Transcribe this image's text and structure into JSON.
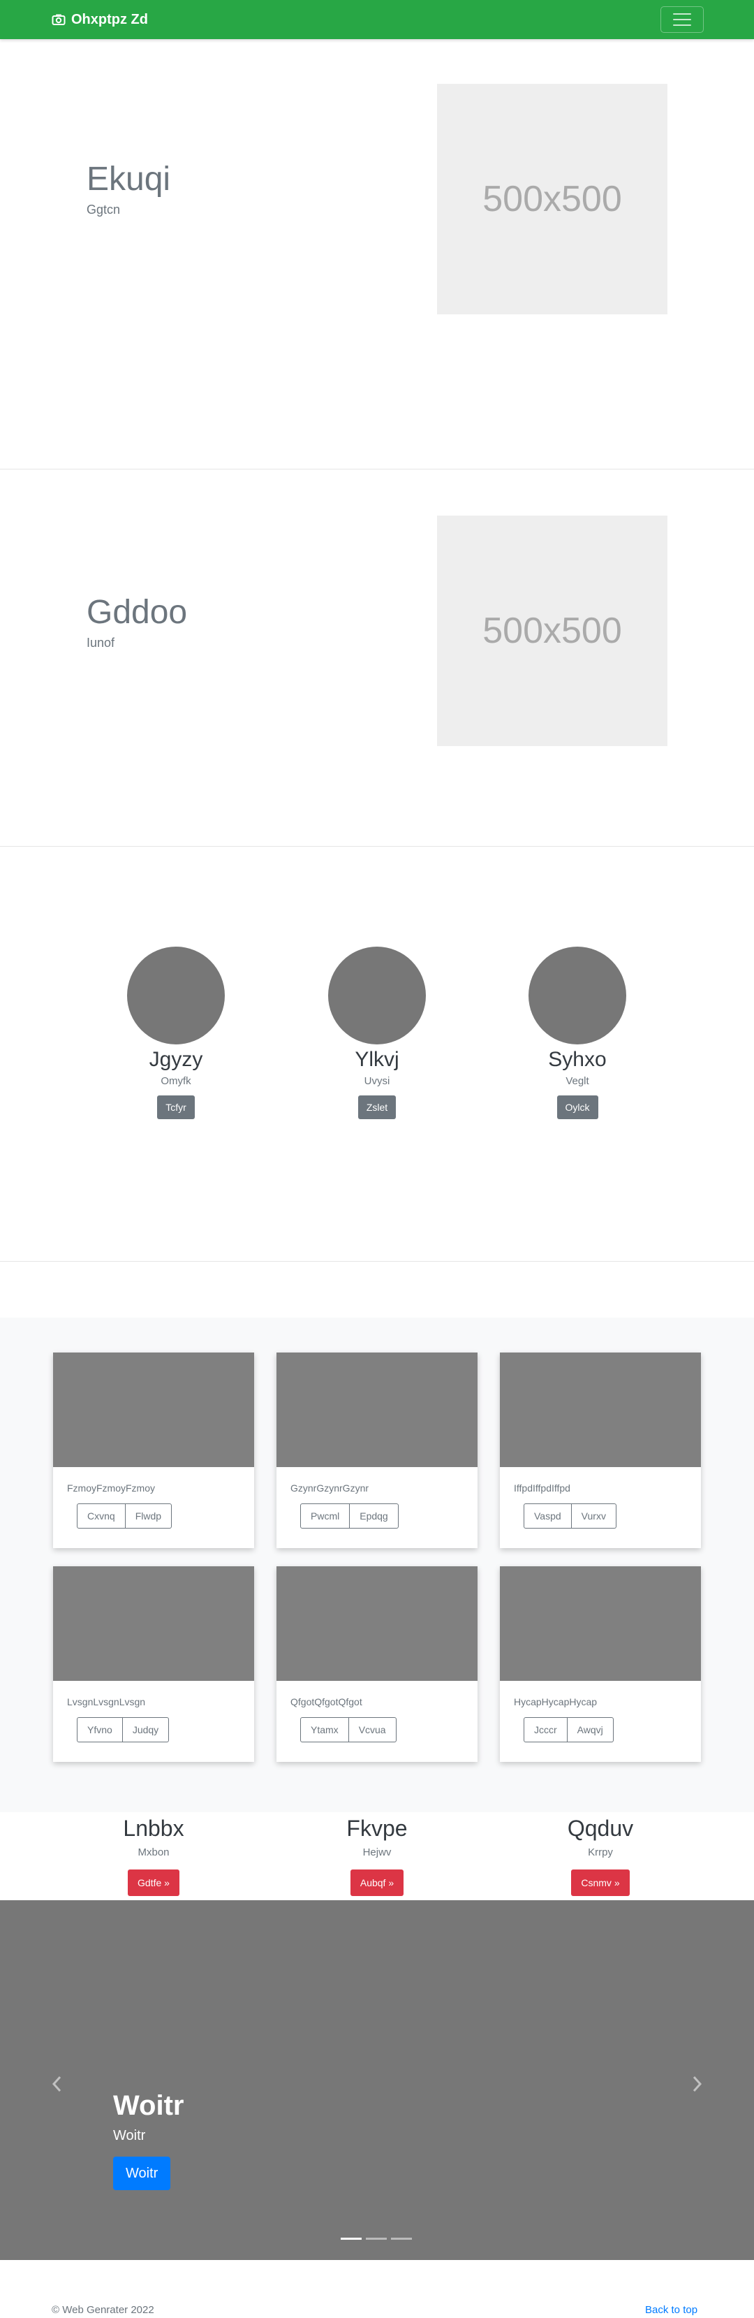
{
  "navbar": {
    "brand": "Ohxptpz Zd",
    "brand_icon": "camera-icon",
    "toggler_icon": "hamburger-menu-icon",
    "color": "#28a745"
  },
  "features": [
    {
      "title": "Ekuqi",
      "subtitle": "Ggtcn",
      "placeholder": "500x500"
    },
    {
      "title": "Gddoo",
      "subtitle": "Iunof",
      "placeholder": "500x500"
    }
  ],
  "team": [
    {
      "name": "Jgyzy",
      "role": "Omyfk",
      "button": "Tcfyr"
    },
    {
      "name": "Ylkvj",
      "role": "Uvysi",
      "button": "Zslet"
    },
    {
      "name": "Syhxo",
      "role": "Veglt",
      "button": "Oylck"
    }
  ],
  "cards": [
    {
      "text": "FzmoyFzmoyFzmoy",
      "buttons": [
        "Cxvnq",
        "Flwdp"
      ]
    },
    {
      "text": "GzynrGzynrGzynr",
      "buttons": [
        "Pwcml",
        "Epdqg"
      ]
    },
    {
      "text": "IffpdIffpdIffpd",
      "buttons": [
        "Vaspd",
        "Vurxv"
      ]
    },
    {
      "text": "LvsgnLvsgnLvsgn",
      "buttons": [
        "Yfvno",
        "Judqy"
      ]
    },
    {
      "text": "QfgotQfgotQfgot",
      "buttons": [
        "Ytamx",
        "Vcvua"
      ]
    },
    {
      "text": "HycapHycapHycap",
      "buttons": [
        "Jcccr",
        "Awqvj"
      ]
    }
  ],
  "columns": [
    {
      "title": "Lnbbx",
      "subtitle": "Mxbon",
      "button": "Gdtfe »"
    },
    {
      "title": "Fkvpe",
      "subtitle": "Hejwv",
      "button": "Aubqf »"
    },
    {
      "title": "Qqduv",
      "subtitle": "Krrpy",
      "button": "Csnmv »"
    }
  ],
  "carousel": {
    "title": "Woitr",
    "subtitle": "Woitr",
    "button": "Woitr",
    "slide_count": 3,
    "active_slide": 1,
    "prev_icon": "chevron-left-icon",
    "next_icon": "chevron-right-icon"
  },
  "footer": {
    "copyright": "© Web Genrater 2022",
    "back_to_top": "Back to top"
  }
}
